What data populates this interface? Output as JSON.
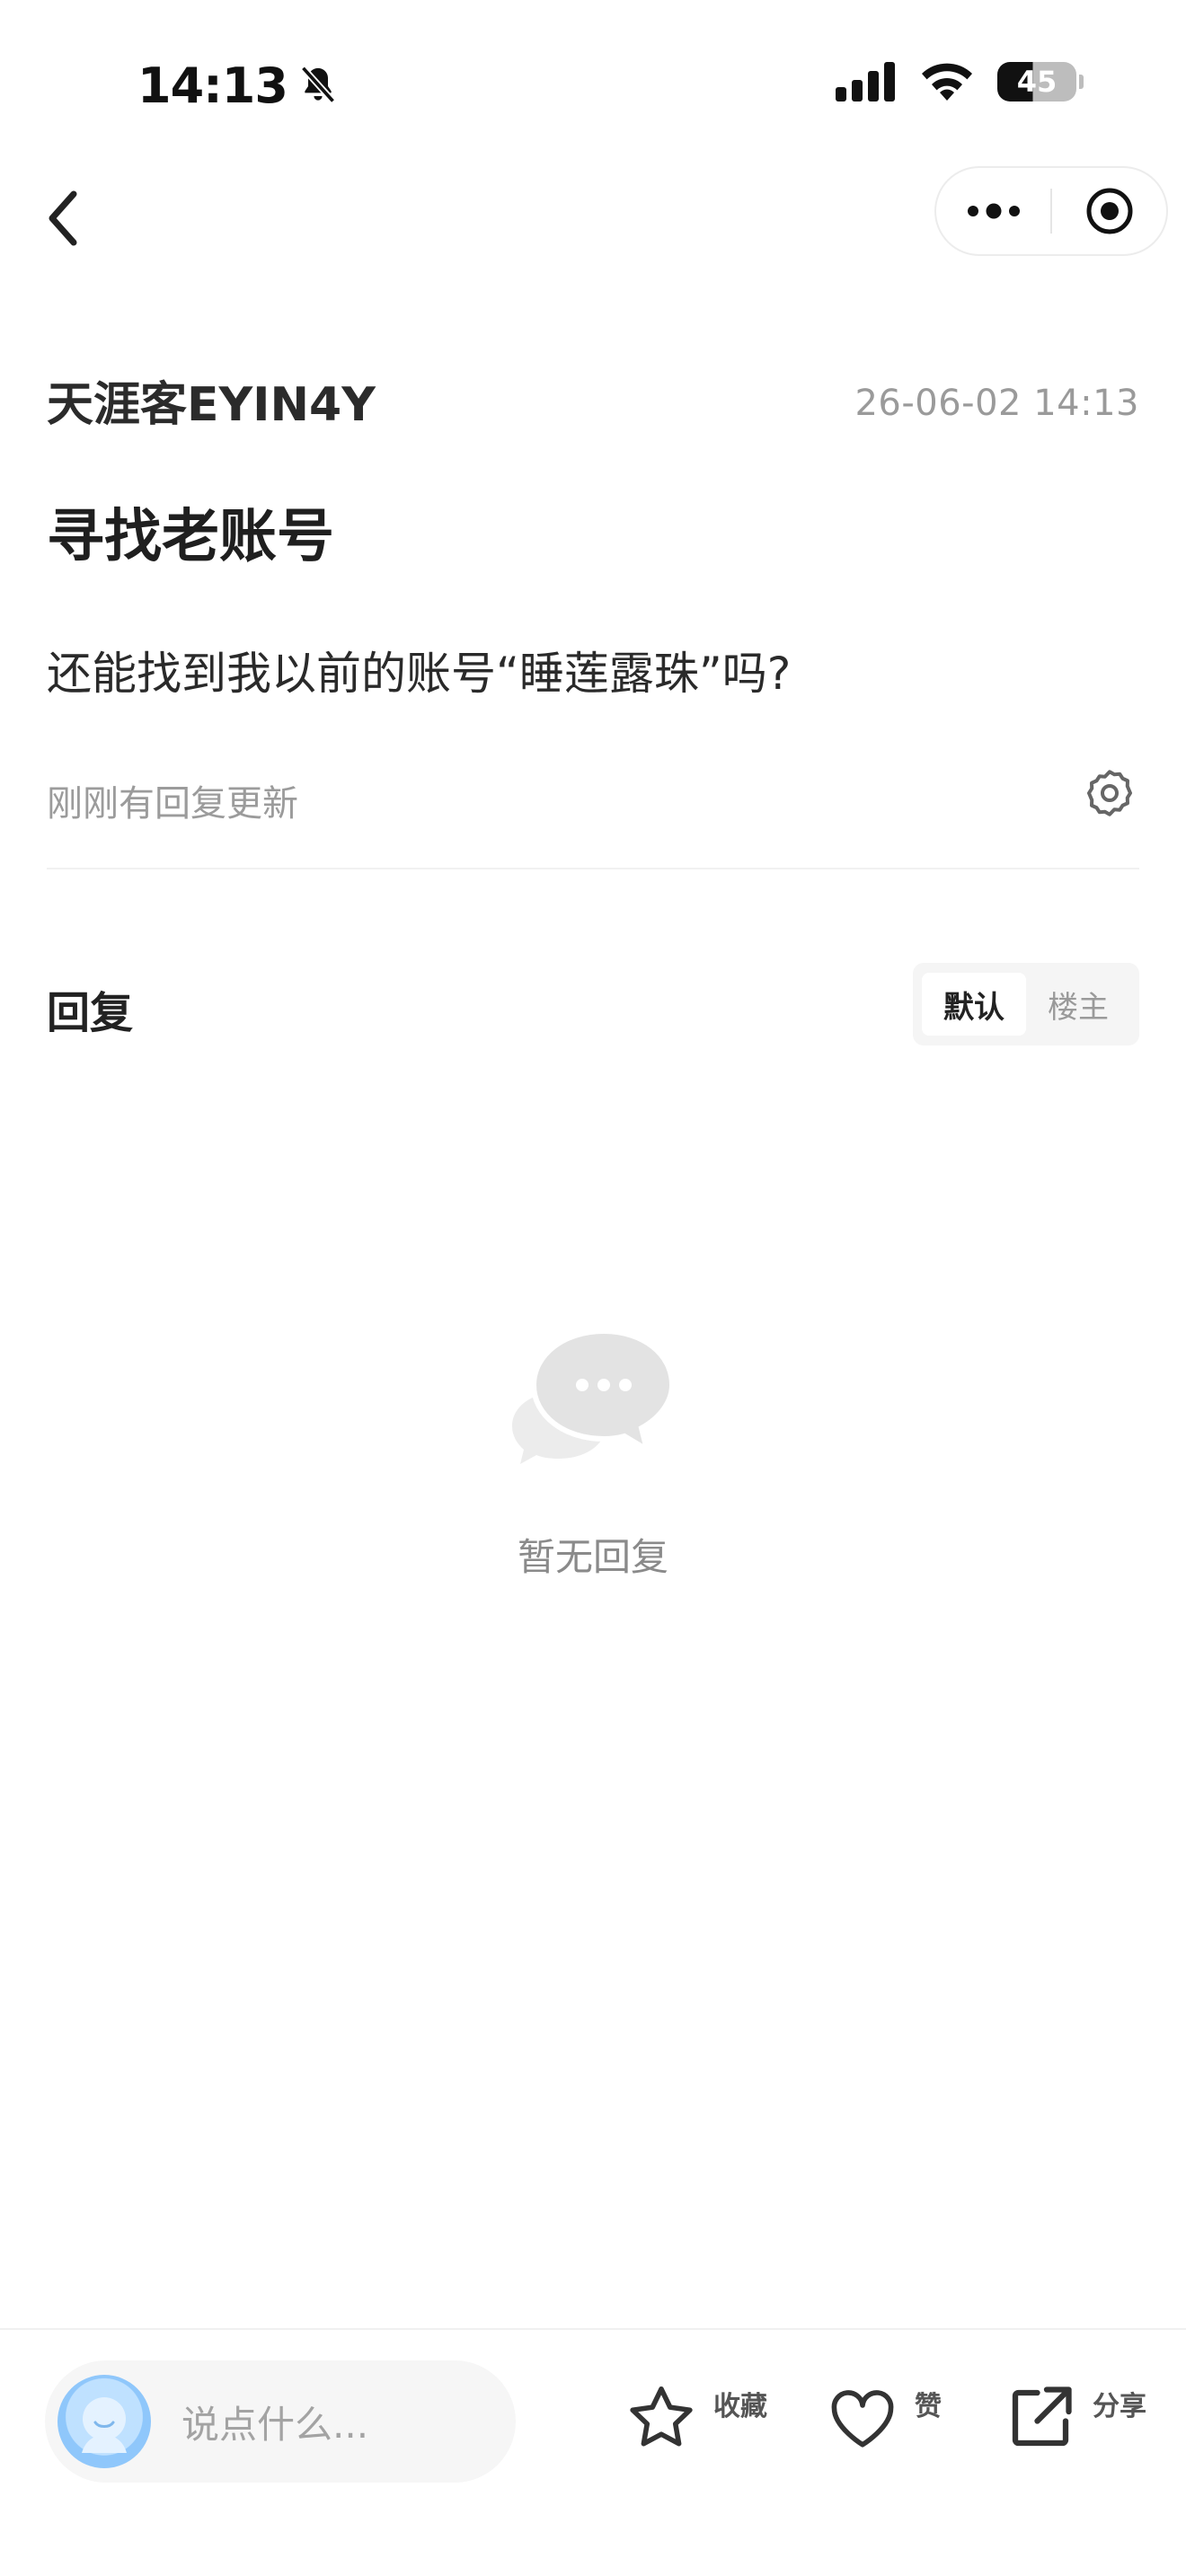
{
  "status_bar": {
    "time": "14:13",
    "battery": "45"
  },
  "post": {
    "author": "天涯客EYIN4Y",
    "time": "26-06-02 14:13",
    "title": "寻找老账号",
    "body": "还能找到我以前的账号“睡莲露珠”吗?",
    "reply_update": "刚刚有回复更新"
  },
  "replies": {
    "title": "回复",
    "sort_options": [
      "默认",
      "楼主"
    ],
    "active_sort": "默认",
    "empty_text": "暂无回复"
  },
  "bottom_bar": {
    "comment_placeholder": "说点什么...",
    "favorite_label": "收藏",
    "like_label": "赞",
    "share_label": "分享"
  },
  "icons": {
    "back": "back-chevron-icon",
    "more": "more-dots-icon",
    "close_mini": "target-icon",
    "settings": "gear-icon",
    "empty": "chat-bubbles-icon",
    "favorite": "star-icon",
    "like": "heart-icon",
    "share": "share-icon"
  }
}
